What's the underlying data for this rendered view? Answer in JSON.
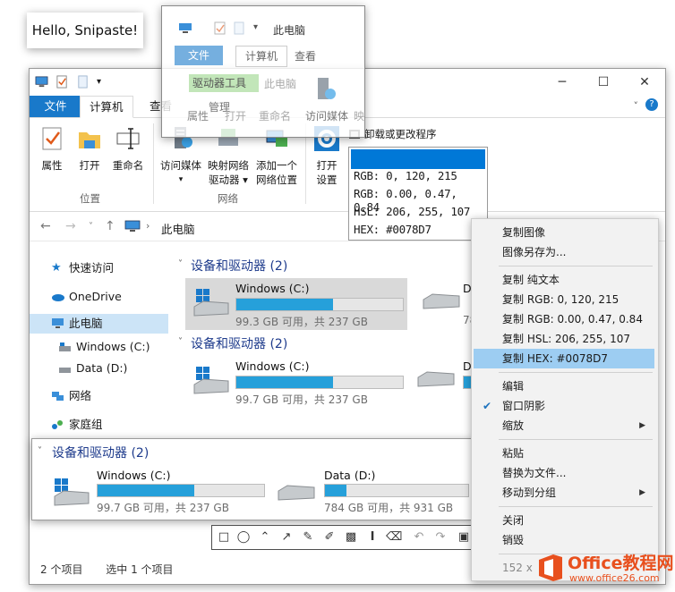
{
  "hello": {
    "text": "Hello, Snipaste!"
  },
  "window": {
    "title_controls": {
      "minimize": "─",
      "maximize": "☐",
      "close": "✕"
    },
    "tabs": {
      "file": "文件",
      "computer": "计算机",
      "view": "查看"
    },
    "ribbon": {
      "properties": "属性",
      "open": "打开",
      "rename": "重命名",
      "media": "访问媒体",
      "map_drive_1": "映射网络",
      "map_drive_2": "驱动器 ▾",
      "add_location_1": "添加一个",
      "add_location_2": "网络位置",
      "open_settings_1": "打开",
      "open_settings_2": "设置",
      "uninstall": "卸载或更改程序",
      "group_location": "位置",
      "group_network": "网络"
    },
    "address": {
      "crumb": "此电脑"
    },
    "sidebar": [
      {
        "label": "快速访问",
        "icon": "star-icon"
      },
      {
        "label": "OneDrive",
        "icon": "cloud-icon"
      },
      {
        "label": "此电脑",
        "icon": "computer-icon"
      },
      {
        "label": "Windows (C:)",
        "icon": "drive-icon"
      },
      {
        "label": "Data (D:)",
        "icon": "drive-icon"
      },
      {
        "label": "网络",
        "icon": "network-icon"
      },
      {
        "label": "家庭组",
        "icon": "homegroup-icon"
      }
    ],
    "section_title": "设备和驱动器 (2)",
    "drives_block1": [
      {
        "name": "Windows (C:)",
        "caption": "99.3 GB 可用，共 237 GB",
        "used": 0.58
      },
      {
        "name": "D",
        "caption": "78",
        "used": 0.15
      }
    ],
    "drives_block2": [
      {
        "name": "Windows (C:)",
        "caption": "99.7 GB 可用，共 237 GB",
        "used": 0.58
      },
      {
        "name": "D",
        "caption": "78",
        "used": 0.15
      }
    ],
    "status": {
      "items": "2 个项目",
      "selected": "选中 1 个项目"
    }
  },
  "ghost": {
    "title": "此电脑",
    "tabs": {
      "file": "文件",
      "computer": "计算机",
      "view": "查看"
    },
    "ribbon_items": [
      "属性",
      "打开",
      "重命名",
      "访问媒体",
      "映"
    ],
    "tool_label": "驱动器工具",
    "manage": "管理",
    "crumb": "此电脑"
  },
  "picker": {
    "rgb": "RGB:   0,  120,  215",
    "rgbf": "RGB: 0.00, 0.47, 0.84",
    "hsl": "HSL:  206,  255,  107",
    "hex": "HEX:     #0078D7",
    "color": "#0078D7"
  },
  "strip": {
    "title": "设备和驱动器 (2)",
    "drives": [
      {
        "name": "Windows (C:)",
        "caption": "99.7 GB 可用，共 237 GB",
        "used": 0.58
      },
      {
        "name": "Data (D:)",
        "caption": "784 GB 可用，共 931 GB",
        "used": 0.15
      }
    ]
  },
  "menu": {
    "copy_image": "复制图像",
    "save_as": "图像另存为...",
    "copy_text": "复制 纯文本",
    "copy_rgb": "复制 RGB: 0, 120, 215",
    "copy_rgbf": "复制 RGB: 0.00, 0.47, 0.84",
    "copy_hsl": "复制 HSL: 206, 255, 107",
    "copy_hex": "复制 HEX: #0078D7",
    "edit": "编辑",
    "shadow": "窗口阴影",
    "zoom": "缩放",
    "paste": "粘贴",
    "replace": "替换为文件...",
    "move_group": "移动到分组",
    "close": "关闭",
    "destroy": "销毁",
    "size": "152 x"
  },
  "logo": {
    "brand": "Office教程网",
    "url": "www.office26.com"
  },
  "colors": {
    "accent": "#1979CA",
    "bar": "#26A0DA",
    "menu_highlight": "#9DCDF2",
    "logo": "#E8501E"
  }
}
